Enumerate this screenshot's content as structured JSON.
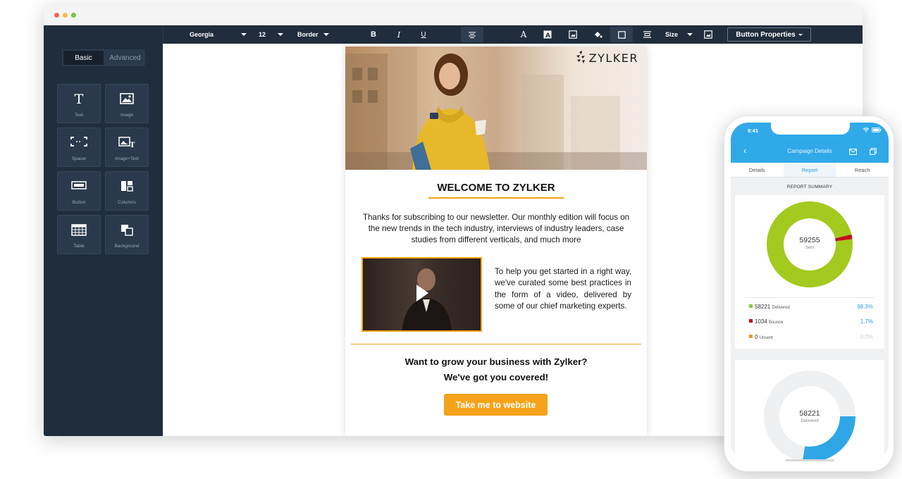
{
  "editor": {
    "sidebar": {
      "tabs": [
        "Basic",
        "Advanced"
      ],
      "blocks": [
        {
          "label": "Text",
          "icon": "text-icon"
        },
        {
          "label": "Image",
          "icon": "image-icon"
        },
        {
          "label": "Spacer",
          "icon": "spacer-icon"
        },
        {
          "label": "Image+Text",
          "icon": "image-text-icon"
        },
        {
          "label": "Button",
          "icon": "button-icon"
        },
        {
          "label": "Columns",
          "icon": "columns-icon"
        },
        {
          "label": "Table",
          "icon": "table-icon"
        },
        {
          "label": "Background",
          "icon": "background-icon"
        }
      ]
    },
    "toolbar": {
      "font": "Georgia",
      "size": "12",
      "border": "Border",
      "size_label": "Size",
      "button_properties": "Button Properties"
    }
  },
  "email": {
    "logo": "ZYLKER",
    "heading": "WELCOME TO ZYLKER",
    "intro": "Thanks for subscribing to our newsletter. Our monthly edition will focus on the new trends in the tech industry, interviews of industry leaders, case studies from different verticals, and much more",
    "side_text": "To help you get started in a right way, we've curated some best practices in the form of a video, delivered by some of our chief marketing experts.",
    "cta_line1": "Want to grow your business with Zylker?",
    "cta_line2": "We've got you covered!",
    "button": "Take me to website"
  },
  "phone": {
    "time": "9:41",
    "title": "Campaign Details",
    "tabs": [
      "Details",
      "Report",
      "Reach"
    ],
    "active_tab": "Report",
    "section_title": "REPORT SUMMARY",
    "summary": {
      "total_value": "59255",
      "total_label": "Sent",
      "rows": [
        {
          "value": "58221",
          "label": "Delivered",
          "pct": "98.3%",
          "color": "#8cc63f"
        },
        {
          "value": "1034",
          "label": "Bounce",
          "pct": "1.7%",
          "color": "#c0111a"
        },
        {
          "value": "0",
          "label": "Unsent",
          "pct": "0.0%",
          "color": "#f29a1a"
        }
      ]
    },
    "second_card": {
      "value": "58221",
      "label": "Delivered"
    }
  },
  "colors": {
    "accent_orange": "#f5a31a",
    "editor_dark": "#1f2d3d",
    "phone_blue": "#30a9e8",
    "donut_green": "#a3ca1e",
    "donut_red": "#c0111a"
  },
  "chart_data": [
    {
      "type": "pie",
      "categories": [
        "Delivered",
        "Bounce",
        "Unsent"
      ],
      "values": [
        58221,
        1034,
        0
      ],
      "total": 59255
    },
    {
      "type": "pie",
      "categories": [
        "Delivered"
      ],
      "values": [
        58221
      ]
    }
  ]
}
